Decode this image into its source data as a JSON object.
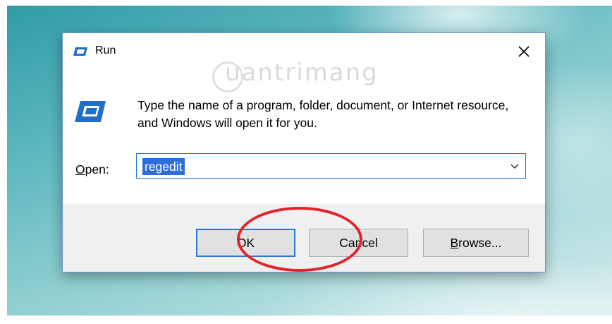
{
  "dialog": {
    "title": "Run",
    "title_icon": "run-icon",
    "close_icon": "close-icon",
    "instruction": "Type the name of a program, folder, document, or Internet resource, and Windows will open it for you.",
    "open_label_underlined": "O",
    "open_label_rest": "pen:",
    "open_value": "regedit",
    "dropdown_icon": "chevron-down-icon"
  },
  "buttons": {
    "ok": "OK",
    "cancel": "Cancel",
    "browse_underlined": "B",
    "browse_rest": "rowse..."
  },
  "watermark": "uantrimang",
  "colors": {
    "accent": "#2b78d4",
    "selection": "#2d6fd6",
    "highlight_ring": "#e0242b"
  }
}
